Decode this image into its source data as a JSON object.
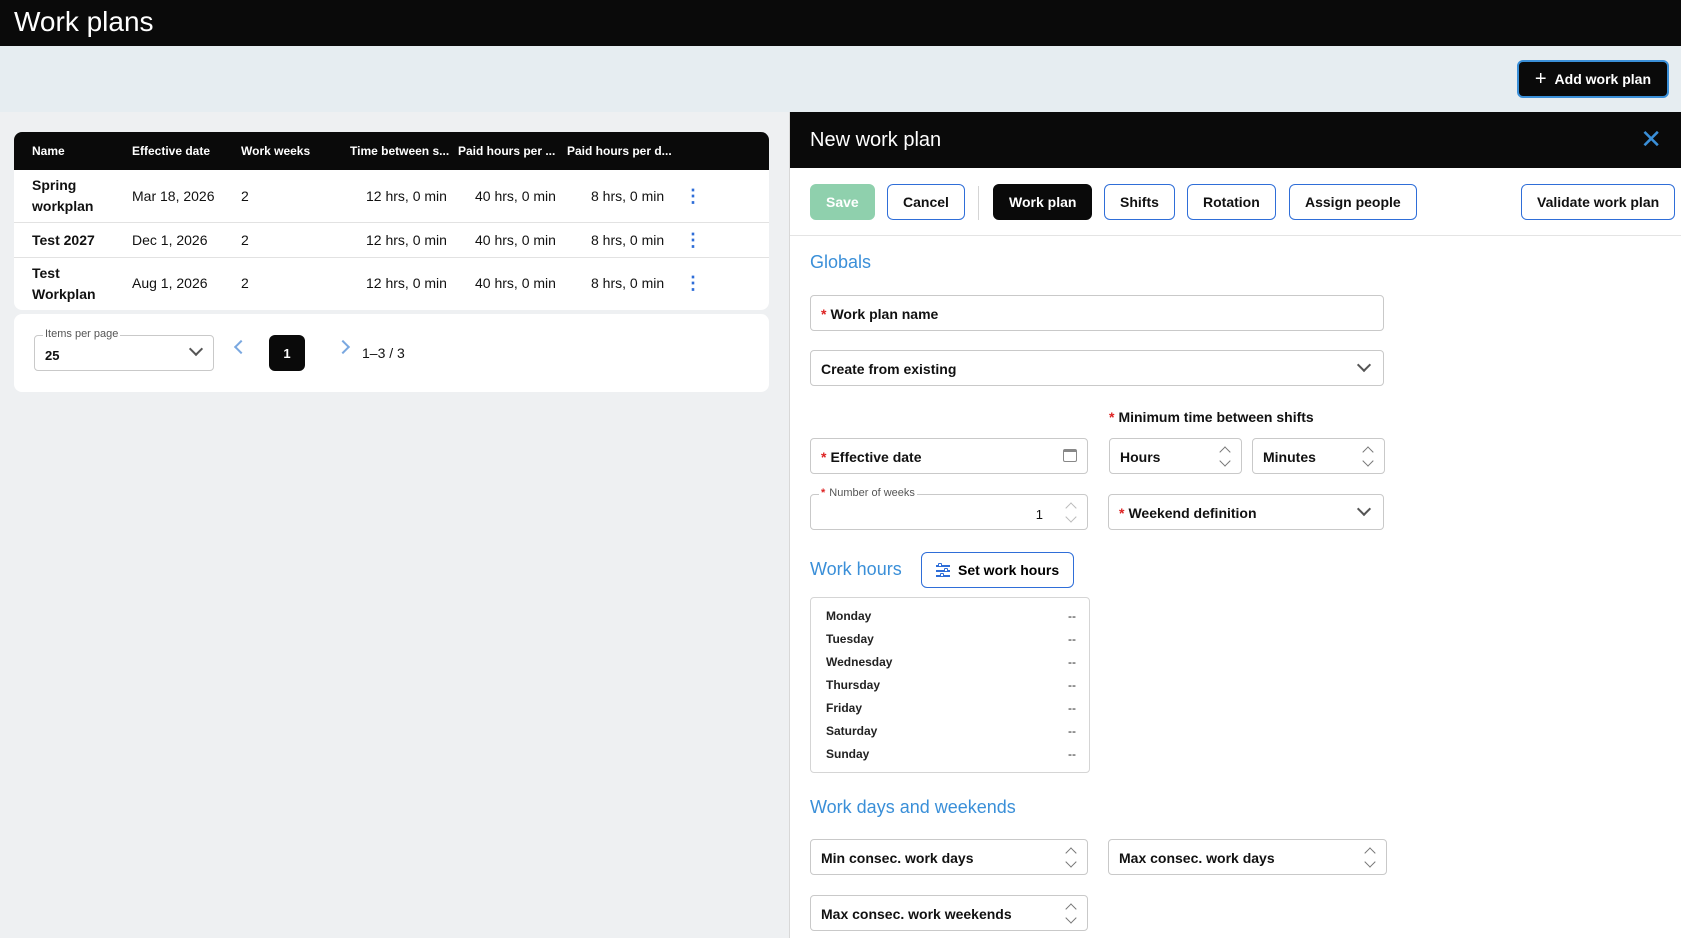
{
  "app": {
    "title": "Work plans"
  },
  "subbar": {
    "add_label": "Add work plan",
    "add_icon": "plus-icon"
  },
  "table": {
    "headers": [
      "Name",
      "Effective date",
      "Work weeks",
      "Time between s...",
      "Paid hours per ...",
      "Paid hours per d..."
    ],
    "rows": [
      {
        "name": "Spring workplan",
        "effective": "Mar 18, 2026",
        "weeks": "2",
        "between": "12 hrs, 0 min",
        "paid_week": "40 hrs, 0 min",
        "paid_day": "8 hrs, 0 min"
      },
      {
        "name": "Test 2027",
        "effective": "Dec 1, 2026",
        "weeks": "2",
        "between": "12 hrs, 0 min",
        "paid_week": "40 hrs, 0 min",
        "paid_day": "8 hrs, 0 min"
      },
      {
        "name": "Test Workplan",
        "effective": "Aug 1, 2026",
        "weeks": "2",
        "between": "12 hrs, 0 min",
        "paid_week": "40 hrs, 0 min",
        "paid_day": "8 hrs, 0 min"
      }
    ]
  },
  "pager": {
    "items_per_page_label": "Items per page",
    "items_per_page": "25",
    "current_page": "1",
    "range": "1–3 / 3"
  },
  "panel": {
    "title": "New work plan",
    "toolbar": {
      "save": "Save",
      "cancel": "Cancel",
      "work_plan": "Work plan",
      "shifts": "Shifts",
      "rotation": "Rotation",
      "assign_people": "Assign people",
      "validate": "Validate work plan"
    },
    "globals": {
      "title": "Globals",
      "work_plan_name": "Work plan name",
      "create_from_existing": "Create from existing",
      "min_time_label": "Minimum time between shifts",
      "effective_date": "Effective date",
      "hours": "Hours",
      "minutes": "Minutes",
      "number_of_weeks_label": "Number of weeks",
      "number_of_weeks": "1",
      "weekend_definition": "Weekend definition"
    },
    "work_hours": {
      "title": "Work hours",
      "set_label": "Set work hours",
      "days": [
        {
          "day": "Monday",
          "value": "--"
        },
        {
          "day": "Tuesday",
          "value": "--"
        },
        {
          "day": "Wednesday",
          "value": "--"
        },
        {
          "day": "Thursday",
          "value": "--"
        },
        {
          "day": "Friday",
          "value": "--"
        },
        {
          "day": "Saturday",
          "value": "--"
        },
        {
          "day": "Sunday",
          "value": "--"
        }
      ]
    },
    "work_days": {
      "title": "Work days and weekends",
      "min_consec_days": "Min consec. work days",
      "max_consec_days": "Max consec. work days",
      "max_consec_weekends": "Max consec. work weekends"
    }
  },
  "colors": {
    "accent": "#3a8fd8",
    "link": "#2f6ed8",
    "save_disabled": "#8fd0ad",
    "required": "#dd2222"
  }
}
